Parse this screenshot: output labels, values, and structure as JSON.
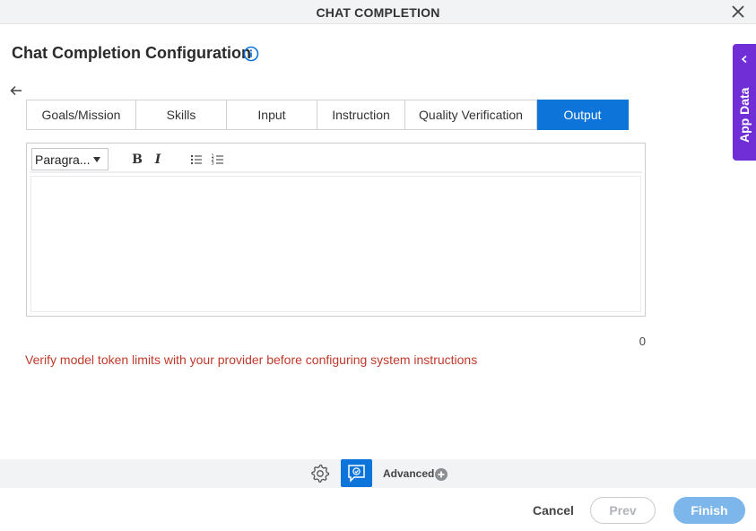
{
  "window": {
    "title": "CHAT COMPLETION"
  },
  "header": {
    "title": "Chat Completion Configuration"
  },
  "tabs": [
    {
      "label": "Goals/Mission"
    },
    {
      "label": "Skills"
    },
    {
      "label": "Input"
    },
    {
      "label": "Instruction"
    },
    {
      "label": "Quality Verification"
    },
    {
      "label": "Output"
    }
  ],
  "active_tab": "Output",
  "editor": {
    "format_select": "Paragra...",
    "bold_label": "B",
    "italic_label": "I",
    "content": ""
  },
  "char_count": "0",
  "warning": "Verify model token limits with your provider before configuring system instructions",
  "side_panel": {
    "label": "App Data"
  },
  "footer": {
    "advanced_label": "Advanced",
    "cancel_label": "Cancel",
    "prev_label": "Prev",
    "finish_label": "Finish"
  },
  "colors": {
    "accent": "#0d74d9",
    "side_panel": "#6f2ed6",
    "warning": "#c0392b",
    "finish_disabled": "#7db6ea"
  }
}
